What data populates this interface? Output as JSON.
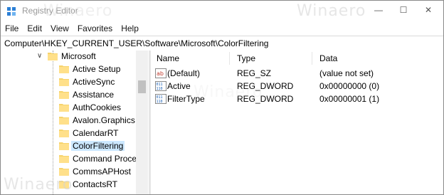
{
  "window": {
    "title": "Registry Editor",
    "watermark": "Winaero",
    "controls": {
      "minimize": "—",
      "maximize": "☐",
      "close": "✕"
    }
  },
  "menu": [
    "File",
    "Edit",
    "View",
    "Favorites",
    "Help"
  ],
  "address": "Computer\\HKEY_CURRENT_USER\\Software\\Microsoft\\ColorFiltering",
  "tree": {
    "parent": "Microsoft",
    "items": [
      "Active Setup",
      "ActiveSync",
      "Assistance",
      "AuthCookies",
      "Avalon.Graphics",
      "CalendarRT",
      "ColorFiltering",
      "Command Proces",
      "CommsAPHost",
      "ContactsRT"
    ],
    "selected": "ColorFiltering"
  },
  "list": {
    "headers": {
      "name": "Name",
      "type": "Type",
      "data": "Data"
    },
    "rows": [
      {
        "icon": "string-value-icon",
        "name": "(Default)",
        "type": "REG_SZ",
        "data": "(value not set)"
      },
      {
        "icon": "dword-value-icon",
        "name": "Active",
        "type": "REG_DWORD",
        "data": "0x00000000 (0)"
      },
      {
        "icon": "dword-value-icon",
        "name": "FilterType",
        "type": "REG_DWORD",
        "data": "0x00000001 (1)"
      }
    ]
  }
}
